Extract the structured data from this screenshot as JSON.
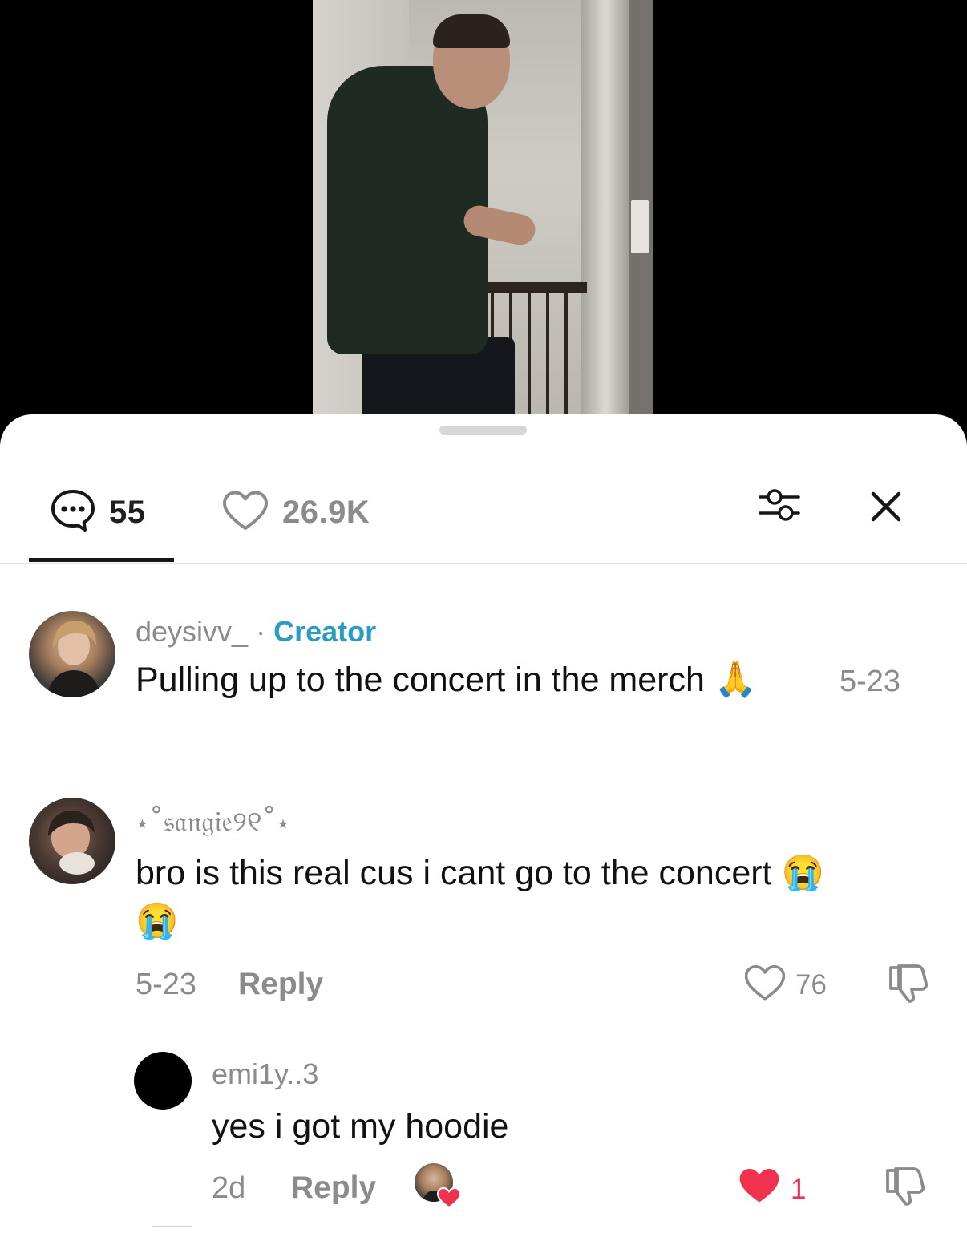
{
  "header": {
    "comments_count": "55",
    "likes_count": "26.9K"
  },
  "comments": [
    {
      "username": "deysivv_",
      "separator": "·",
      "badge": "Creator",
      "text": "Pulling up to the concert in the merch",
      "emoji": "🙏",
      "date": "5-23"
    },
    {
      "username": "⋆˚𝔰𝔞𝔫𝔤𝔦𝔢୨୧˚⋆",
      "text_line1": "bro is this real cus i cant go to the concert",
      "emoji1": "😭",
      "emoji2": "😭",
      "date": "5-23",
      "reply_label": "Reply",
      "likes": "76"
    }
  ],
  "replies": [
    {
      "username": "emi1y..3",
      "text": "yes i got my hoodie",
      "age": "2d",
      "reply_label": "Reply",
      "likes": "1",
      "liked_by_creator": true
    }
  ],
  "colors": {
    "creator_badge": "#2a9bc3",
    "liked_heart": "#f0324f",
    "muted_text": "#8b8b8b"
  }
}
